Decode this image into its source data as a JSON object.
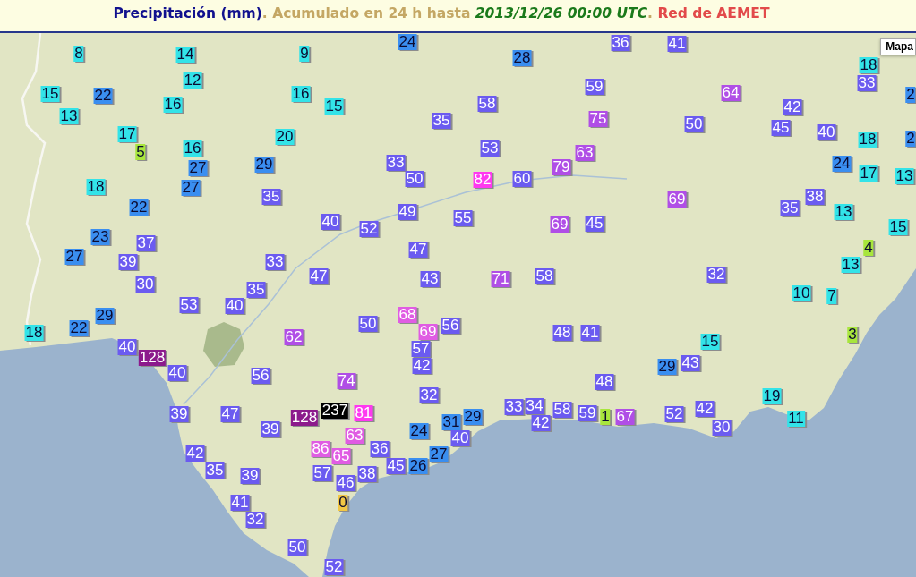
{
  "title": {
    "parts": [
      {
        "text": "Precipitación (mm)",
        "kind": "variable"
      },
      {
        "text": ". Acumulado en 24 h hasta",
        "kind": "plain"
      },
      {
        "text": "2013/12/26 00:00 UTC",
        "kind": "date"
      },
      {
        "text": ".",
        "kind": "plain"
      },
      {
        "text": "Red de AEMET",
        "kind": "source"
      }
    ]
  },
  "map": {
    "type_button": "Mapa",
    "stations": [
      {
        "value": "24",
        "color": "#3a8ef0"
      },
      {
        "value": "36",
        "color": "#6b5bf0"
      },
      {
        "value": "41",
        "color": "#6b5bf0"
      },
      {
        "value": "8",
        "color": "#33e3e8"
      },
      {
        "value": "14",
        "color": "#33e3e8"
      },
      {
        "value": "9",
        "color": "#33e3e8"
      },
      {
        "value": "28",
        "color": "#3a8ef0"
      },
      {
        "value": "18",
        "color": "#33e3e8"
      },
      {
        "value": "12",
        "color": "#33e3e8"
      },
      {
        "value": "59",
        "color": "#6b5bf0"
      },
      {
        "value": "33",
        "color": "#6b5bf0"
      },
      {
        "value": "15",
        "color": "#33e3e8"
      },
      {
        "value": "22",
        "color": "#3a8ef0"
      },
      {
        "value": "16",
        "color": "#33e3e8"
      },
      {
        "value": "64",
        "color": "#b04ee6"
      },
      {
        "value": "2",
        "color": "#3a8ef0"
      },
      {
        "value": "16",
        "color": "#33e3e8"
      },
      {
        "value": "15",
        "color": "#33e3e8"
      },
      {
        "value": "58",
        "color": "#6b5bf0"
      },
      {
        "value": "42",
        "color": "#6b5bf0"
      },
      {
        "value": "13",
        "color": "#33e3e8"
      },
      {
        "value": "35",
        "color": "#6b5bf0"
      },
      {
        "value": "75",
        "color": "#b04ee6"
      },
      {
        "value": "50",
        "color": "#6b5bf0"
      },
      {
        "value": "17",
        "color": "#33e3e8"
      },
      {
        "value": "20",
        "color": "#33e3e8"
      },
      {
        "value": "45",
        "color": "#6b5bf0"
      },
      {
        "value": "40",
        "color": "#6b5bf0"
      },
      {
        "value": "18",
        "color": "#33e3e8"
      },
      {
        "value": "2",
        "color": "#3a8ef0"
      },
      {
        "value": "5",
        "color": "#a8e63c"
      },
      {
        "value": "16",
        "color": "#33e3e8"
      },
      {
        "value": "53",
        "color": "#6b5bf0"
      },
      {
        "value": "63",
        "color": "#b04ee6"
      },
      {
        "value": "27",
        "color": "#3a8ef0"
      },
      {
        "value": "29",
        "color": "#3a8ef0"
      },
      {
        "value": "33",
        "color": "#6b5bf0"
      },
      {
        "value": "79",
        "color": "#b04ee6"
      },
      {
        "value": "24",
        "color": "#3a8ef0"
      },
      {
        "value": "50",
        "color": "#6b5bf0"
      },
      {
        "value": "82",
        "color": "#ff38f0"
      },
      {
        "value": "60",
        "color": "#6b5bf0"
      },
      {
        "value": "17",
        "color": "#33e3e8"
      },
      {
        "value": "13",
        "color": "#33e3e8"
      },
      {
        "value": "18",
        "color": "#33e3e8"
      },
      {
        "value": "27",
        "color": "#3a8ef0"
      },
      {
        "value": "35",
        "color": "#6b5bf0"
      },
      {
        "value": "69",
        "color": "#b04ee6"
      },
      {
        "value": "38",
        "color": "#6b5bf0"
      },
      {
        "value": "22",
        "color": "#3a8ef0"
      },
      {
        "value": "49",
        "color": "#6b5bf0"
      },
      {
        "value": "55",
        "color": "#6b5bf0"
      },
      {
        "value": "35",
        "color": "#6b5bf0"
      },
      {
        "value": "13",
        "color": "#33e3e8"
      },
      {
        "value": "40",
        "color": "#6b5bf0"
      },
      {
        "value": "52",
        "color": "#6b5bf0"
      },
      {
        "value": "69",
        "color": "#b04ee6"
      },
      {
        "value": "45",
        "color": "#6b5bf0"
      },
      {
        "value": "15",
        "color": "#33e3e8"
      },
      {
        "value": "23",
        "color": "#3a8ef0"
      },
      {
        "value": "37",
        "color": "#6b5bf0"
      },
      {
        "value": "47",
        "color": "#6b5bf0"
      },
      {
        "value": "4",
        "color": "#a8e63c"
      },
      {
        "value": "27",
        "color": "#3a8ef0"
      },
      {
        "value": "39",
        "color": "#6b5bf0"
      },
      {
        "value": "33",
        "color": "#6b5bf0"
      },
      {
        "value": "13",
        "color": "#33e3e8"
      },
      {
        "value": "47",
        "color": "#6b5bf0"
      },
      {
        "value": "43",
        "color": "#6b5bf0"
      },
      {
        "value": "71",
        "color": "#b04ee6"
      },
      {
        "value": "58",
        "color": "#6b5bf0"
      },
      {
        "value": "32",
        "color": "#6b5bf0"
      },
      {
        "value": "30",
        "color": "#6b5bf0"
      },
      {
        "value": "35",
        "color": "#6b5bf0"
      },
      {
        "value": "10",
        "color": "#33e3e8"
      },
      {
        "value": "7",
        "color": "#33e3e8"
      },
      {
        "value": "53",
        "color": "#6b5bf0"
      },
      {
        "value": "40",
        "color": "#6b5bf0"
      },
      {
        "value": "29",
        "color": "#3a8ef0"
      },
      {
        "value": "68",
        "color": "#e05ce3"
      },
      {
        "value": "18",
        "color": "#33e3e8"
      },
      {
        "value": "22",
        "color": "#3a8ef0"
      },
      {
        "value": "62",
        "color": "#b04ee6"
      },
      {
        "value": "50",
        "color": "#6b5bf0"
      },
      {
        "value": "69",
        "color": "#e05ce3"
      },
      {
        "value": "56",
        "color": "#6b5bf0"
      },
      {
        "value": "48",
        "color": "#6b5bf0"
      },
      {
        "value": "41",
        "color": "#6b5bf0"
      },
      {
        "value": "15",
        "color": "#33e3e8"
      },
      {
        "value": "3",
        "color": "#a8e63c"
      },
      {
        "value": "40",
        "color": "#6b5bf0"
      },
      {
        "value": "128",
        "color": "#8c1a8c"
      },
      {
        "value": "57",
        "color": "#6b5bf0"
      },
      {
        "value": "40",
        "color": "#6b5bf0"
      },
      {
        "value": "56",
        "color": "#6b5bf0"
      },
      {
        "value": "74",
        "color": "#b04ee6"
      },
      {
        "value": "42",
        "color": "#6b5bf0"
      },
      {
        "value": "48",
        "color": "#6b5bf0"
      },
      {
        "value": "29",
        "color": "#3a8ef0"
      },
      {
        "value": "43",
        "color": "#6b5bf0"
      },
      {
        "value": "32",
        "color": "#6b5bf0"
      },
      {
        "value": "19",
        "color": "#33e3e8"
      },
      {
        "value": "39",
        "color": "#6b5bf0"
      },
      {
        "value": "47",
        "color": "#6b5bf0"
      },
      {
        "value": "128",
        "color": "#8c1a8c"
      },
      {
        "value": "237",
        "color": "#000000"
      },
      {
        "value": "81",
        "color": "#ff38f0"
      },
      {
        "value": "31",
        "color": "#3a8ef0"
      },
      {
        "value": "29",
        "color": "#3a8ef0"
      },
      {
        "value": "33",
        "color": "#6b5bf0"
      },
      {
        "value": "34",
        "color": "#6b5bf0"
      },
      {
        "value": "42",
        "color": "#6b5bf0"
      },
      {
        "value": "58",
        "color": "#6b5bf0"
      },
      {
        "value": "59",
        "color": "#6b5bf0"
      },
      {
        "value": "1",
        "color": "#a8e63c"
      },
      {
        "value": "67",
        "color": "#b04ee6"
      },
      {
        "value": "52",
        "color": "#6b5bf0"
      },
      {
        "value": "42",
        "color": "#6b5bf0"
      },
      {
        "value": "30",
        "color": "#6b5bf0"
      },
      {
        "value": "11",
        "color": "#33e3e8"
      },
      {
        "value": "39",
        "color": "#6b5bf0"
      },
      {
        "value": "63",
        "color": "#e05ce3"
      },
      {
        "value": "24",
        "color": "#3a8ef0"
      },
      {
        "value": "40",
        "color": "#6b5bf0"
      },
      {
        "value": "42",
        "color": "#6b5bf0"
      },
      {
        "value": "86",
        "color": "#e05ce3"
      },
      {
        "value": "65",
        "color": "#e05ce3"
      },
      {
        "value": "36",
        "color": "#6b5bf0"
      },
      {
        "value": "27",
        "color": "#3a8ef0"
      },
      {
        "value": "35",
        "color": "#6b5bf0"
      },
      {
        "value": "39",
        "color": "#6b5bf0"
      },
      {
        "value": "57",
        "color": "#6b5bf0"
      },
      {
        "value": "38",
        "color": "#6b5bf0"
      },
      {
        "value": "45",
        "color": "#6b5bf0"
      },
      {
        "value": "26",
        "color": "#3a8ef0"
      },
      {
        "value": "46",
        "color": "#6b5bf0"
      },
      {
        "value": "41",
        "color": "#6b5bf0"
      },
      {
        "value": "0",
        "color": "#f2c744"
      },
      {
        "value": "32",
        "color": "#6b5bf0"
      },
      {
        "value": "50",
        "color": "#6b5bf0"
      },
      {
        "value": "52",
        "color": "#6b5bf0"
      }
    ]
  }
}
